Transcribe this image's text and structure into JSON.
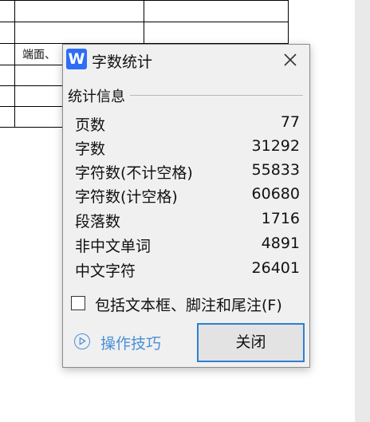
{
  "document": {
    "cell_text": "端面、"
  },
  "dialog": {
    "app_icon_letter": "W",
    "title": "字数统计",
    "section_label": "统计信息",
    "stats": [
      {
        "label": "页数",
        "value": "77"
      },
      {
        "label": "字数",
        "value": "31292"
      },
      {
        "label": "字符数(不计空格)",
        "value": "55833"
      },
      {
        "label": "字符数(计空格)",
        "value": "60680"
      },
      {
        "label": "段落数",
        "value": "1716"
      },
      {
        "label": "非中文单词",
        "value": "4891"
      },
      {
        "label": "中文字符",
        "value": "26401"
      }
    ],
    "include_checkbox_label": "包括文本框、脚注和尾注(F)",
    "include_checked": false,
    "tips_label": "操作技巧",
    "close_button_label": "关闭"
  },
  "colors": {
    "accent": "#2f7fd1",
    "link": "#4a8fd8",
    "app_icon": "#2f6df5",
    "dialog_bg": "#f0f0f0"
  },
  "icons": [
    "close-icon",
    "wps-writer-app-icon",
    "play-circle-icon"
  ]
}
